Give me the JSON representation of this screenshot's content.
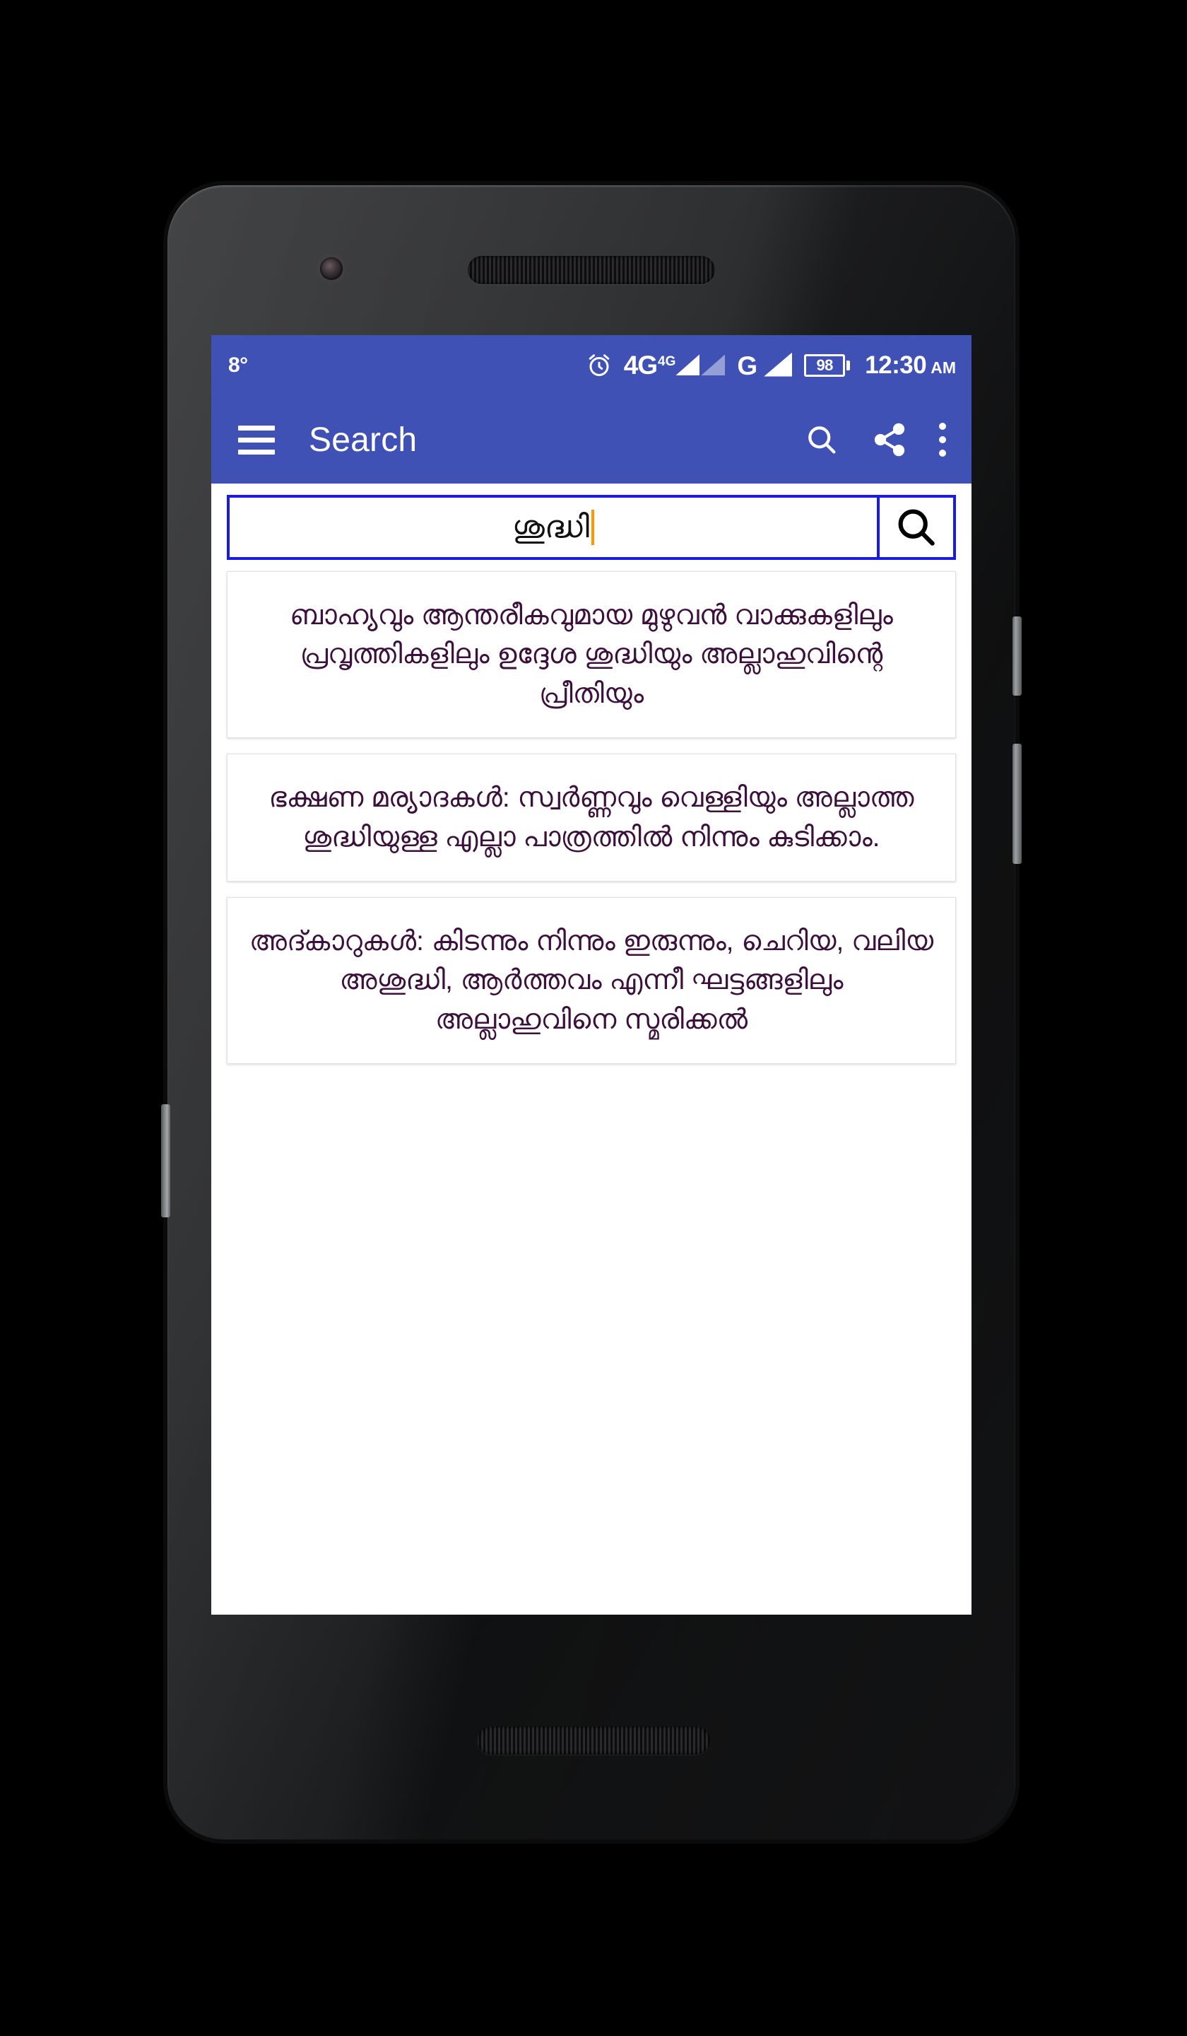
{
  "status_bar": {
    "temperature": "8°",
    "alarm_icon": "alarm-clock-icon",
    "network_1": {
      "label": "4G",
      "superscript": "4G",
      "signal_icon": "signal-bars-icon"
    },
    "network_2": {
      "label": "G",
      "signal_icon": "signal-bars-icon"
    },
    "battery_level": "98",
    "time": "12:30",
    "meridiem": "AM",
    "background_color": "#3f51b5"
  },
  "app_bar": {
    "menu_icon": "hamburger-menu-icon",
    "title": "Search",
    "actions": [
      {
        "name": "search-icon"
      },
      {
        "name": "share-icon"
      },
      {
        "name": "overflow-menu-icon"
      }
    ],
    "background_color": "#3f51b5"
  },
  "search": {
    "value": "ശുദ്ധി",
    "placeholder": "",
    "border_color": "#1a1ae6",
    "caret_color": "#ff9800",
    "submit_icon": "search-icon"
  },
  "results": {
    "text_color": "#3d0f3d",
    "items": [
      {
        "text": "ബാഹ്യവും ആന്തരീകവുമായ മുഴുവൻ വാക്കുകളിലും പ്രവൃത്തികളിലും ഉദ്ദേശ ശുദ്ധിയും അല്ലാഹുവിന്റെ പ്രീതിയും"
      },
      {
        "text": "ഭക്ഷണ മര്യാദകൾ: സ്വർണ്ണവും വെള്ളിയും അല്ലാത്ത ശുദ്ധിയുള്ള എല്ലാ പാത്രത്തിൽ നിന്നും കുടിക്കാം."
      },
      {
        "text": "അദ്കാറുകൾ: കിടന്നും നിന്നും ഇരുന്നും, ചെറിയ, വലിയ അശുദ്ധി, ആർത്തവം എന്നീ ഘട്ടങ്ങളിലും അല്ലാഹുവിനെ സ്മരിക്കൽ"
      }
    ]
  },
  "device": {
    "front_camera": "front-camera-icon",
    "earpiece": "earpiece-speaker-icon",
    "bottom_speaker": "bottom-speaker-icon",
    "buttons": [
      "power-button",
      "volume-up-button",
      "volume-left-button"
    ]
  }
}
